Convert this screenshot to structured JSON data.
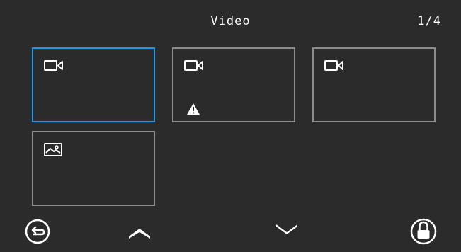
{
  "header": {
    "title": "Video",
    "page_counter": "1/4"
  },
  "tiles": [
    {
      "type": "video",
      "selected": true,
      "warning": false
    },
    {
      "type": "video",
      "selected": false,
      "warning": true
    },
    {
      "type": "video",
      "selected": false,
      "warning": false
    },
    {
      "type": "photo",
      "selected": false,
      "warning": false
    }
  ],
  "toolbar": {
    "buttons": [
      "back-icon",
      "chevron-up-icon",
      "chevron-down-icon",
      "lock-icon"
    ]
  },
  "colors": {
    "background": "#2b2b2b",
    "selected_border": "#1e9be8",
    "tile_border": "#8c8c8c"
  }
}
